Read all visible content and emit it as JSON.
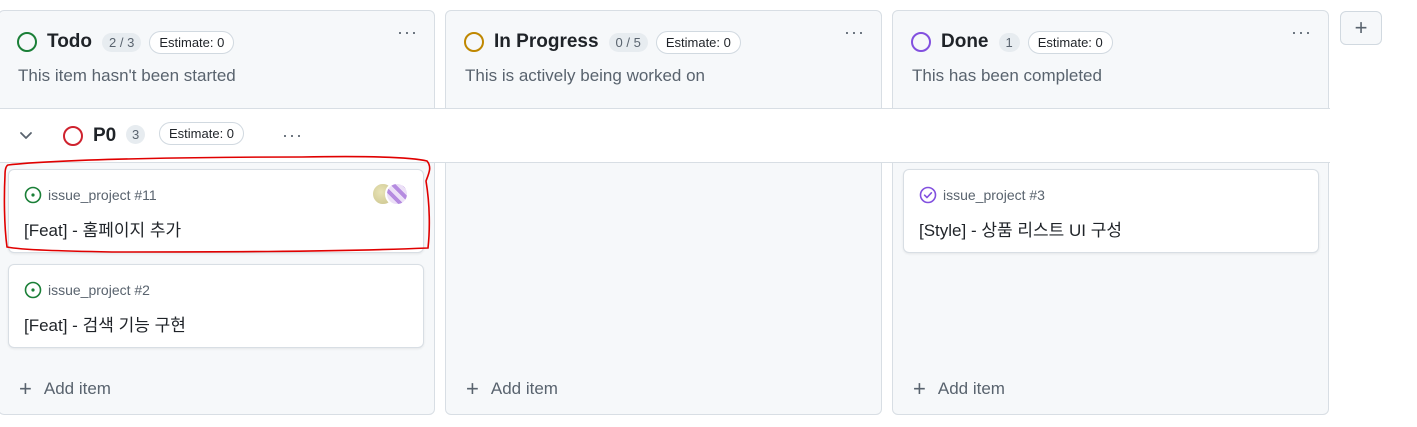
{
  "columns": [
    {
      "title": "Todo",
      "count": "2 / 3",
      "estimate": "Estimate: 0",
      "more": "···",
      "description": "This item hasn't been started",
      "add_item": "Add item",
      "color": "#1a7f37"
    },
    {
      "title": "In Progress",
      "count": "0 / 5",
      "estimate": "Estimate: 0",
      "more": "···",
      "description": "This is actively being worked on",
      "add_item": "Add item",
      "color": "#bf8700"
    },
    {
      "title": "Done",
      "count": "1",
      "estimate": "Estimate: 0",
      "more": "···",
      "description": "This has been completed",
      "add_item": "Add item",
      "color": "#8250df"
    }
  ],
  "group": {
    "title": "P0",
    "count": "3",
    "estimate": "Estimate: 0",
    "more": "···",
    "color": "#cf222e"
  },
  "cards": [
    {
      "ref": "issue_project #11",
      "title": "[Feat] - 홈페이지 추가",
      "status": "open",
      "column": "Todo"
    },
    {
      "ref": "issue_project #2",
      "title": "[Feat] - 검색 기능 구현",
      "status": "open",
      "column": "Todo"
    },
    {
      "ref": "issue_project #3",
      "title": "[Style] - 상품 리스트 UI 구성",
      "status": "closed",
      "column": "Done"
    }
  ],
  "icons": {
    "open_issue": "issue-opened-icon",
    "closed_issue": "issue-closed-icon",
    "add": "plus-icon",
    "collapse": "chevron-down-icon"
  },
  "colors": {
    "open": "#1a7f37",
    "closed": "#8250df",
    "highlight": "#e00000"
  },
  "add_column_label": "+"
}
